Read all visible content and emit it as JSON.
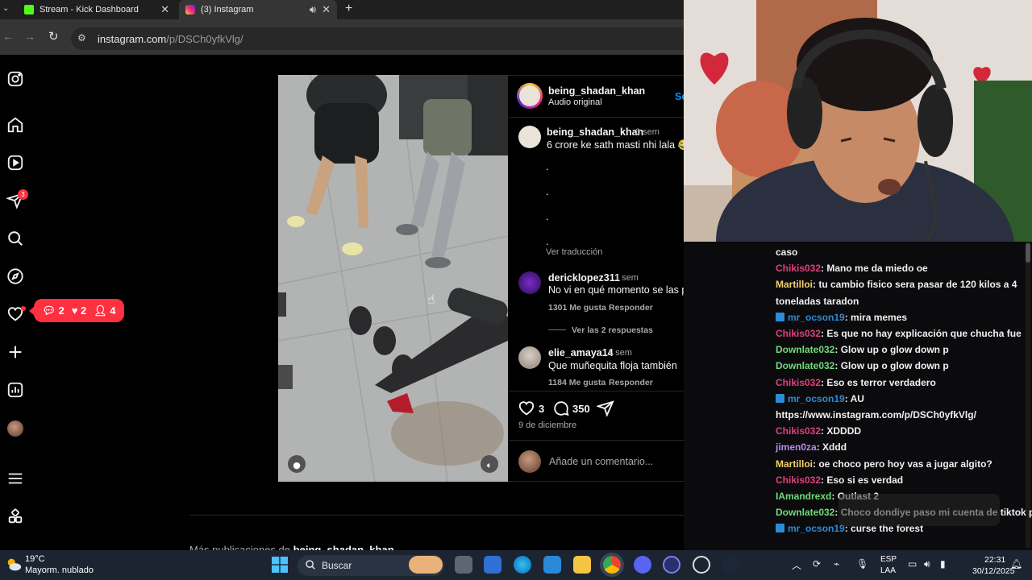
{
  "browser": {
    "tabs": [
      {
        "title": "Stream - Kick Dashboard"
      },
      {
        "title": "(3) Instagram"
      }
    ],
    "url_host": "instagram.com",
    "url_path": "/p/DSCh0yfkVlg/"
  },
  "instagram": {
    "notifications_badge": "3",
    "activity": {
      "comments": "2",
      "likes": "2",
      "follows": "4"
    },
    "post": {
      "author": "being_shadan_khan",
      "audio": "Audio original",
      "follow_partial": "Se",
      "caption_author": "being_shadan_khan",
      "caption_age": "3 sem",
      "caption_text": "6 crore ke sath masti nhi lala 😂",
      "caption_dots": [
        ".",
        ".",
        ".",
        "."
      ],
      "see_translation": "Ver traducción",
      "comments": [
        {
          "user": "dericklopez311",
          "age": "1 sem",
          "text": "No vi en qué momento se las pisa",
          "likes": "1301 Me gusta",
          "reply": "Responder",
          "replies": "Ver las 2 respuestas"
        },
        {
          "user": "elie_amaya14",
          "age": "1 sem",
          "text": "Que muñequita floja también",
          "likes": "1184 Me gusta",
          "reply": "Responder"
        }
      ],
      "like_count": "3",
      "comment_count": "350",
      "date": "9 de diciembre",
      "comment_placeholder": "Añade un comentario..."
    },
    "more_posts_prefix": "Más publicaciones de",
    "more_posts_user": "being_shadan_khan"
  },
  "chat": {
    "messages": [
      {
        "user": "",
        "text": "caso",
        "color": "#f0f0f0",
        "badge": false
      },
      {
        "user": "Chikis032",
        "text": ": Mano me da miedo oe",
        "color": "#e0407a",
        "badge": false
      },
      {
        "user": "Martilloi",
        "text": ": tu cambio fisico sera pasar de 120 kilos a 4",
        "color": "#f2d06b",
        "badge": false
      },
      {
        "user": "",
        "text": "toneladas taradon",
        "color": "#f0f0f0",
        "badge": false
      },
      {
        "user": "mr_ocson19",
        "text": ": mira memes",
        "color": "#2d8bd6",
        "badge": true
      },
      {
        "user": "Chikis032",
        "text": ": Es que no hay explicación que chucha fue",
        "color": "#e0407a",
        "badge": false
      },
      {
        "user": "Downlate032",
        "text": ": Glow up o glow down p",
        "color": "#6fdc7a",
        "badge": false
      },
      {
        "user": "Downlate032",
        "text": ": Glow up o glow down p",
        "color": "#6fdc7a",
        "badge": false
      },
      {
        "user": "Chikis032",
        "text": ": Eso es terror verdadero",
        "color": "#e0407a",
        "badge": false
      },
      {
        "user": "mr_ocson19",
        "text": ": AU",
        "color": "#2d8bd6",
        "badge": true
      },
      {
        "user": "",
        "text": "https://www.instagram.com/p/DSCh0yfkVlg/",
        "color": "#f0f0f0",
        "badge": false
      },
      {
        "user": "Chikis032",
        "text": ": XDDDD",
        "color": "#e0407a",
        "badge": false
      },
      {
        "user": "jimen0za",
        "text": ": Xddd",
        "color": "#b78cf0",
        "badge": false
      },
      {
        "user": "Martilloi",
        "text": ": oe choco pero hoy vas a jugar algito?",
        "color": "#f2d06b",
        "badge": false
      },
      {
        "user": "Chikis032",
        "text": ": Eso si es verdad",
        "color": "#e0407a",
        "badge": false
      },
      {
        "user": "IAmandrexd",
        "text": ": Outlast 2",
        "color": "#6fdc7a",
        "badge": false
      },
      {
        "user": "Downlate032",
        "text": ": Choco dondiye paso mi cuenta de tiktok p",
        "color": "#6fdc7a",
        "badge": false
      },
      {
        "user": "mr_ocson19",
        "text": ": curse the forest",
        "color": "#2d8bd6",
        "badge": true
      }
    ]
  },
  "taskbar": {
    "temperature": "19°C",
    "weather": "Mayorm. nublado",
    "search_placeholder": "Buscar",
    "lang_1": "ESP",
    "lang_2": "LAA",
    "time": "22:31",
    "date": "30/12/2025"
  },
  "colors": {
    "instagram_red": "#ff3040",
    "kick_green": "#53fc18",
    "chrome_dark": "#353535"
  }
}
